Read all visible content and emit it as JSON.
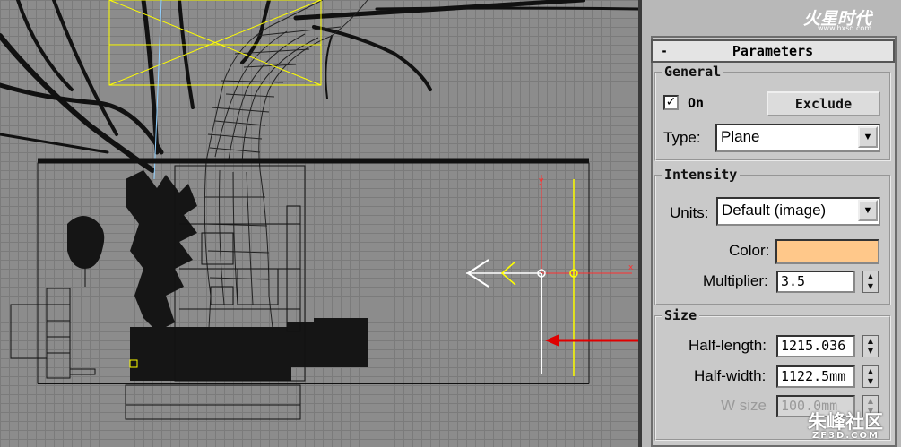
{
  "watermarks": {
    "top_brand": "火星时代",
    "top_url": "www.hxsd.com",
    "bottom_brand": "朱峰社区",
    "bottom_url": "ZF3D.COM"
  },
  "viewport": {
    "axis_x_label": "x",
    "axis_y_label": "y"
  },
  "rollout": {
    "collapse_symbol": "-",
    "title": "Parameters"
  },
  "general": {
    "title": "General",
    "on_label": "On",
    "on_checked": true,
    "check_mark": "✓",
    "exclude_label": "Exclude",
    "type_label": "Type:",
    "type_value": "Plane"
  },
  "intensity": {
    "title": "Intensity",
    "units_label": "Units:",
    "units_value": "Default (image)",
    "color_label": "Color:",
    "color_value": "#ffc88a",
    "multiplier_label": "Multiplier:",
    "multiplier_value": "3.5"
  },
  "size": {
    "title": "Size",
    "half_length_label": "Half-length:",
    "half_length_value": "1215.036",
    "half_width_label": "Half-width:",
    "half_width_value": "1122.5mm",
    "w_size_label": "W size",
    "w_size_value": "100.0mm"
  },
  "icons": {
    "dropdown_arrow": "▼",
    "spinner_up": "▲",
    "spinner_down": "▼"
  },
  "colors": {
    "selection": "#ffff00",
    "arrow_annotation": "#e00000",
    "gizmo_x": "#ff3030"
  }
}
